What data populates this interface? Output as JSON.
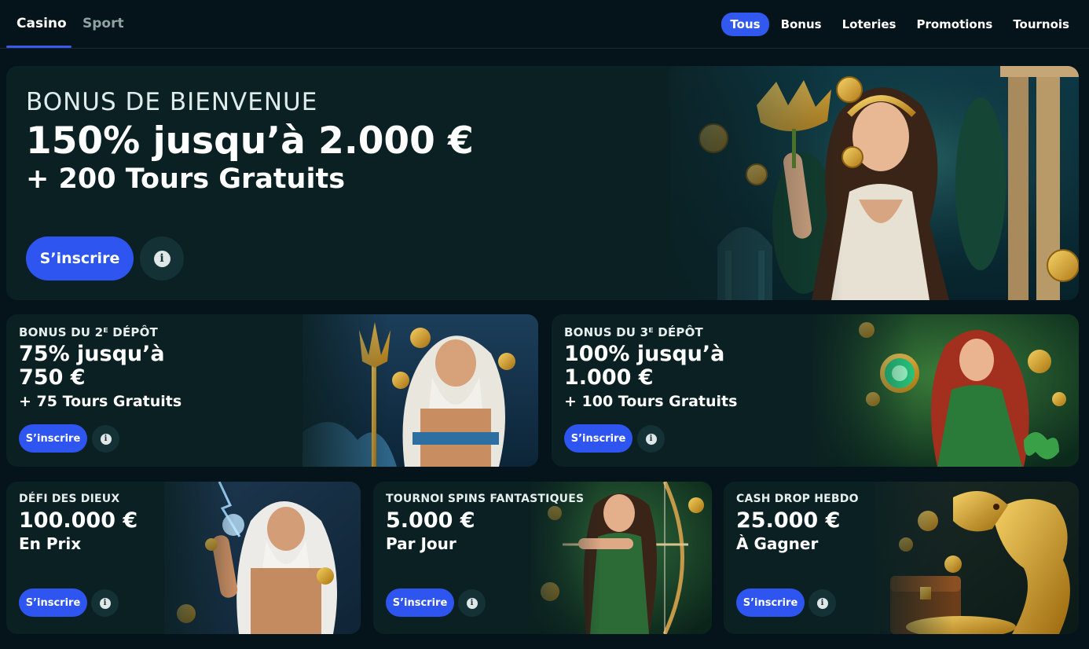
{
  "nav": {
    "main_tabs": [
      {
        "label": "Casino",
        "active": true
      },
      {
        "label": "Sport",
        "active": false
      }
    ],
    "filters": [
      {
        "label": "Tous",
        "active": true
      },
      {
        "label": "Bonus",
        "active": false
      },
      {
        "label": "Loteries",
        "active": false
      },
      {
        "label": "Promotions",
        "active": false
      },
      {
        "label": "Tournois",
        "active": false
      }
    ]
  },
  "hero": {
    "kicker": "BONUS DE BIENVENUE",
    "headline": "150% jusqu’à 2.000 €",
    "sub": "+ 200 Tours Gratuits",
    "cta": "S’inscrire",
    "info_icon": "info-icon",
    "art": "goddess-with-golden-lotus-and-coins"
  },
  "deposit_cards": [
    {
      "kicker": "BONUS DU 2ᴱ DÉPÔT",
      "headline_line1": "75% jusqu’à",
      "headline_line2": "750 €",
      "sub": "+ 75 Tours Gratuits",
      "cta": "S’inscrire",
      "art": "poseidon-with-trident"
    },
    {
      "kicker": "BONUS DU 3ᴱ DÉPÔT",
      "headline_line1": "100% jusqu’à",
      "headline_line2": "1.000 €",
      "sub": "+ 100 Tours Gratuits",
      "cta": "S’inscrire",
      "art": "goddess-with-green-orb"
    }
  ],
  "promo_cards": [
    {
      "kicker": "DÉFI DES DIEUX",
      "headline": "100.000 €",
      "sub": "En Prix",
      "cta": "S’inscrire",
      "art": "zeus-with-lightning"
    },
    {
      "kicker": "TOURNOI SPINS FANTASTIQUES",
      "headline": "5.000 €",
      "sub": "Par Jour",
      "cta": "S’inscrire",
      "art": "archer-huntress"
    },
    {
      "kicker": "CASH DROP HEBDO",
      "headline": "25.000 €",
      "sub": "À Gagner",
      "cta": "S’inscrire",
      "art": "golden-dragon-with-treasure-chest"
    }
  ],
  "colors": {
    "background": "#04141a",
    "card": "#0b2022",
    "accent": "#2e55f0",
    "info_button": "#143236"
  }
}
